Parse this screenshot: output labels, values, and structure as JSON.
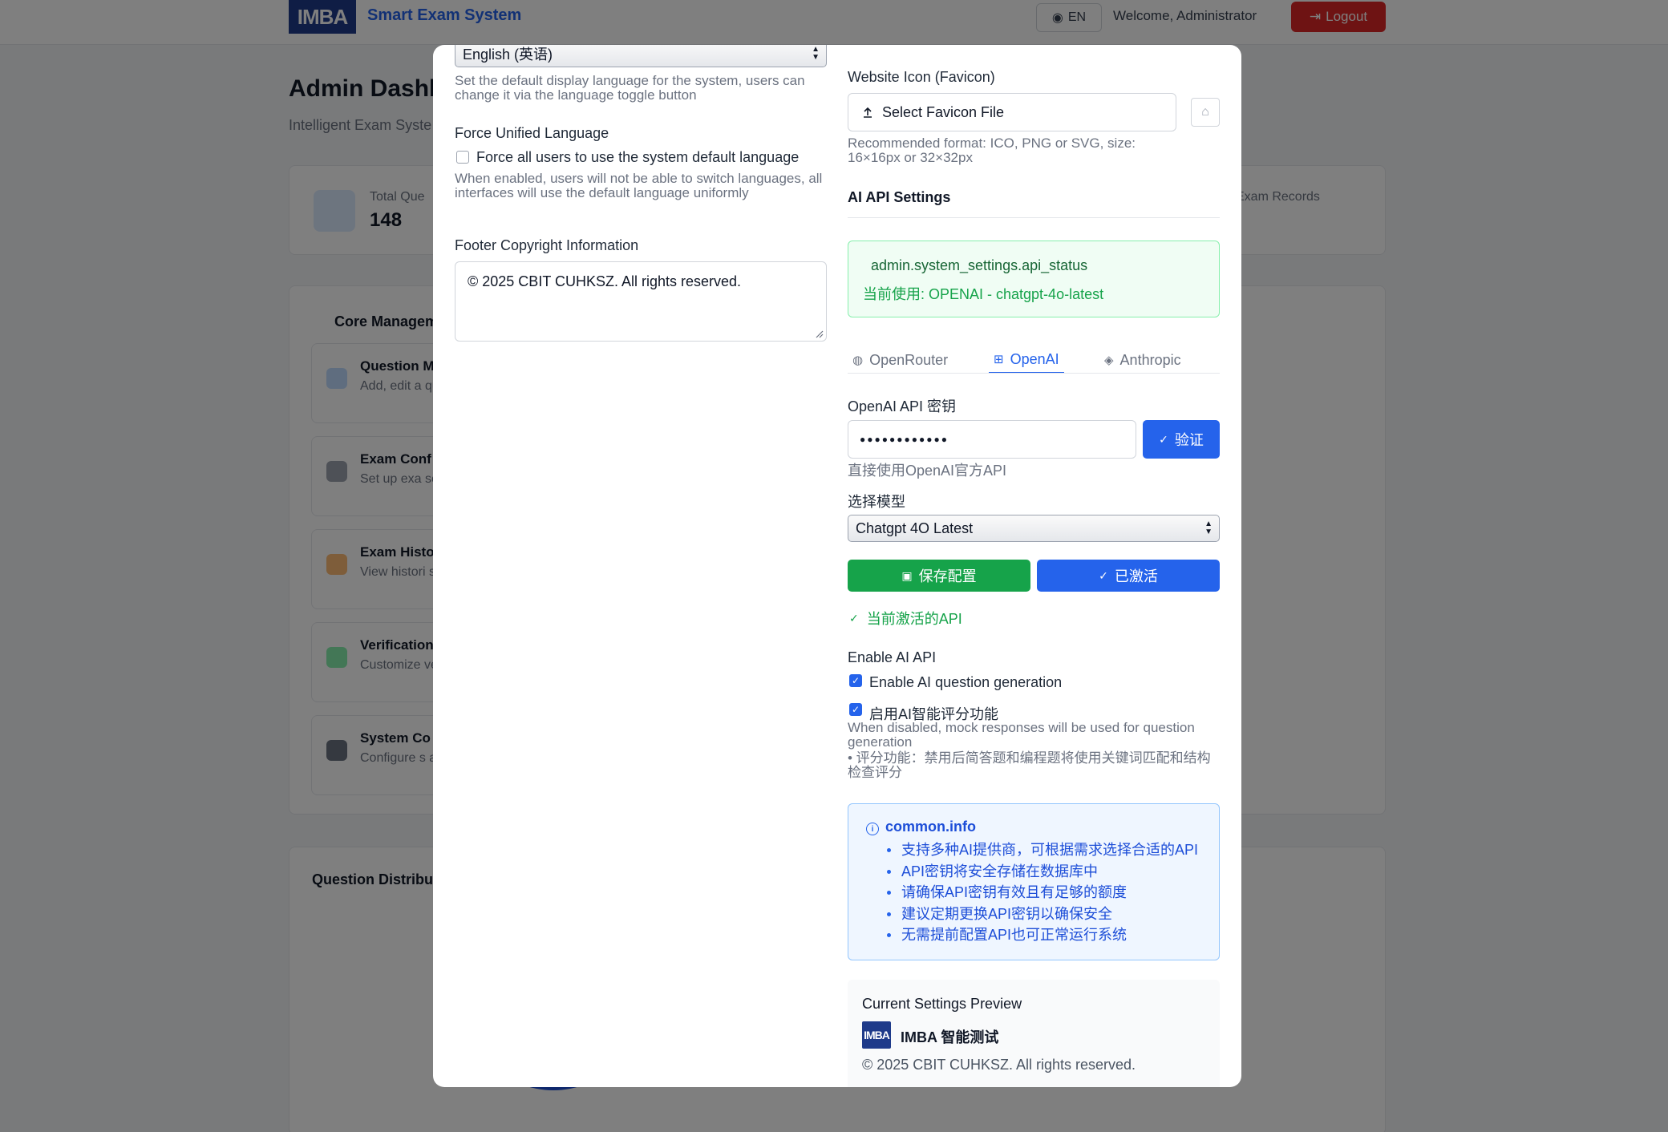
{
  "background": {
    "logo_text": "IMBA",
    "app_name": "Smart Exam System",
    "lang_button": "EN",
    "welcome": "Welcome, Administrator",
    "logout": "Logout",
    "title": "Admin Dashb",
    "subtitle": "Intelligent Exam Syste",
    "stat_left_label": "Total Que",
    "stat_left_value": "148",
    "stat_right_label": "Exam Records",
    "core_title": "Core Managem",
    "items": [
      {
        "title": "Question M",
        "desc": "Add, edit a questions"
      },
      {
        "title": "Exam Conf",
        "desc": "Set up exa settings"
      },
      {
        "title": "Exam Histo",
        "desc": "View histori student info"
      },
      {
        "title": "Verification",
        "desc": "Customize verification"
      },
      {
        "title": "System Co",
        "desc": "Configure s appearance"
      }
    ],
    "distribution_title": "Question Distributi"
  },
  "left": {
    "language_select": "English (英语)",
    "language_help": "Set the default display language for the system, users can change it via the language toggle button",
    "force_label": "Force Unified Language",
    "force_checkbox_label": "Force all users to use the system default language",
    "force_help": "When enabled, users will not be able to switch languages, all interfaces will use the default language uniformly",
    "footer_label": "Footer Copyright Information",
    "footer_value": "© 2025 CBIT CUHKSZ. All rights reserved."
  },
  "right": {
    "favicon_label": "Website Icon (Favicon)",
    "favicon_button": "Select Favicon File",
    "favicon_help": "Recommended format: ICO, PNG or SVG, size: 16×16px or 32×32px",
    "ai_section_title": "AI API Settings",
    "status_title": "admin.system_settings.api_status",
    "status_text": "当前使用: OPENAI - chatgpt-4o-latest",
    "tabs": [
      {
        "label": "OpenRouter",
        "icon": "globe-icon"
      },
      {
        "label": "OpenAI",
        "icon": "chip-icon"
      },
      {
        "label": "Anthropic",
        "icon": "robot-icon"
      }
    ],
    "active_tab": "OpenAI",
    "api_key_label": "OpenAI API 密钥",
    "api_key_value": "●●●●●●●●●●●●",
    "verify_button": "验证",
    "api_key_help": "直接使用OpenAI官方API",
    "model_label": "选择模型",
    "model_select": "Chatgpt 4O Latest",
    "save_button": "保存配置",
    "activated_button": "已激活",
    "active_note": "当前激活的API",
    "enable_label": "Enable AI API",
    "enable_generation_label": "Enable AI question generation",
    "enable_generation_checked": true,
    "enable_grading_label": "启用AI智能评分功能",
    "enable_grading_checked": true,
    "enable_help_1": "When disabled, mock responses will be used for question generation",
    "enable_help_2": "• 评分功能：禁用后简答题和编程题将使用关键词匹配和结构检查评分",
    "info_title": "common.info",
    "info_items": [
      "支持多种AI提供商，可根据需求选择合适的API",
      "API密钥将安全存储在数据库中",
      "请确保API密钥有效且有足够的额度",
      "建议定期更换API密钥以确保安全",
      "无需提前配置API也可正常运行系统"
    ],
    "preview_title": "Current Settings Preview",
    "preview_logo_text": "IMBA",
    "preview_name": "IMBA 智能测试",
    "preview_footer": "© 2025 CBIT CUHKSZ. All rights reserved."
  },
  "colors": {
    "primary": "#2563eb",
    "success": "#16a34a",
    "danger": "#dc2626",
    "brand_navy": "#1e3a8a"
  }
}
